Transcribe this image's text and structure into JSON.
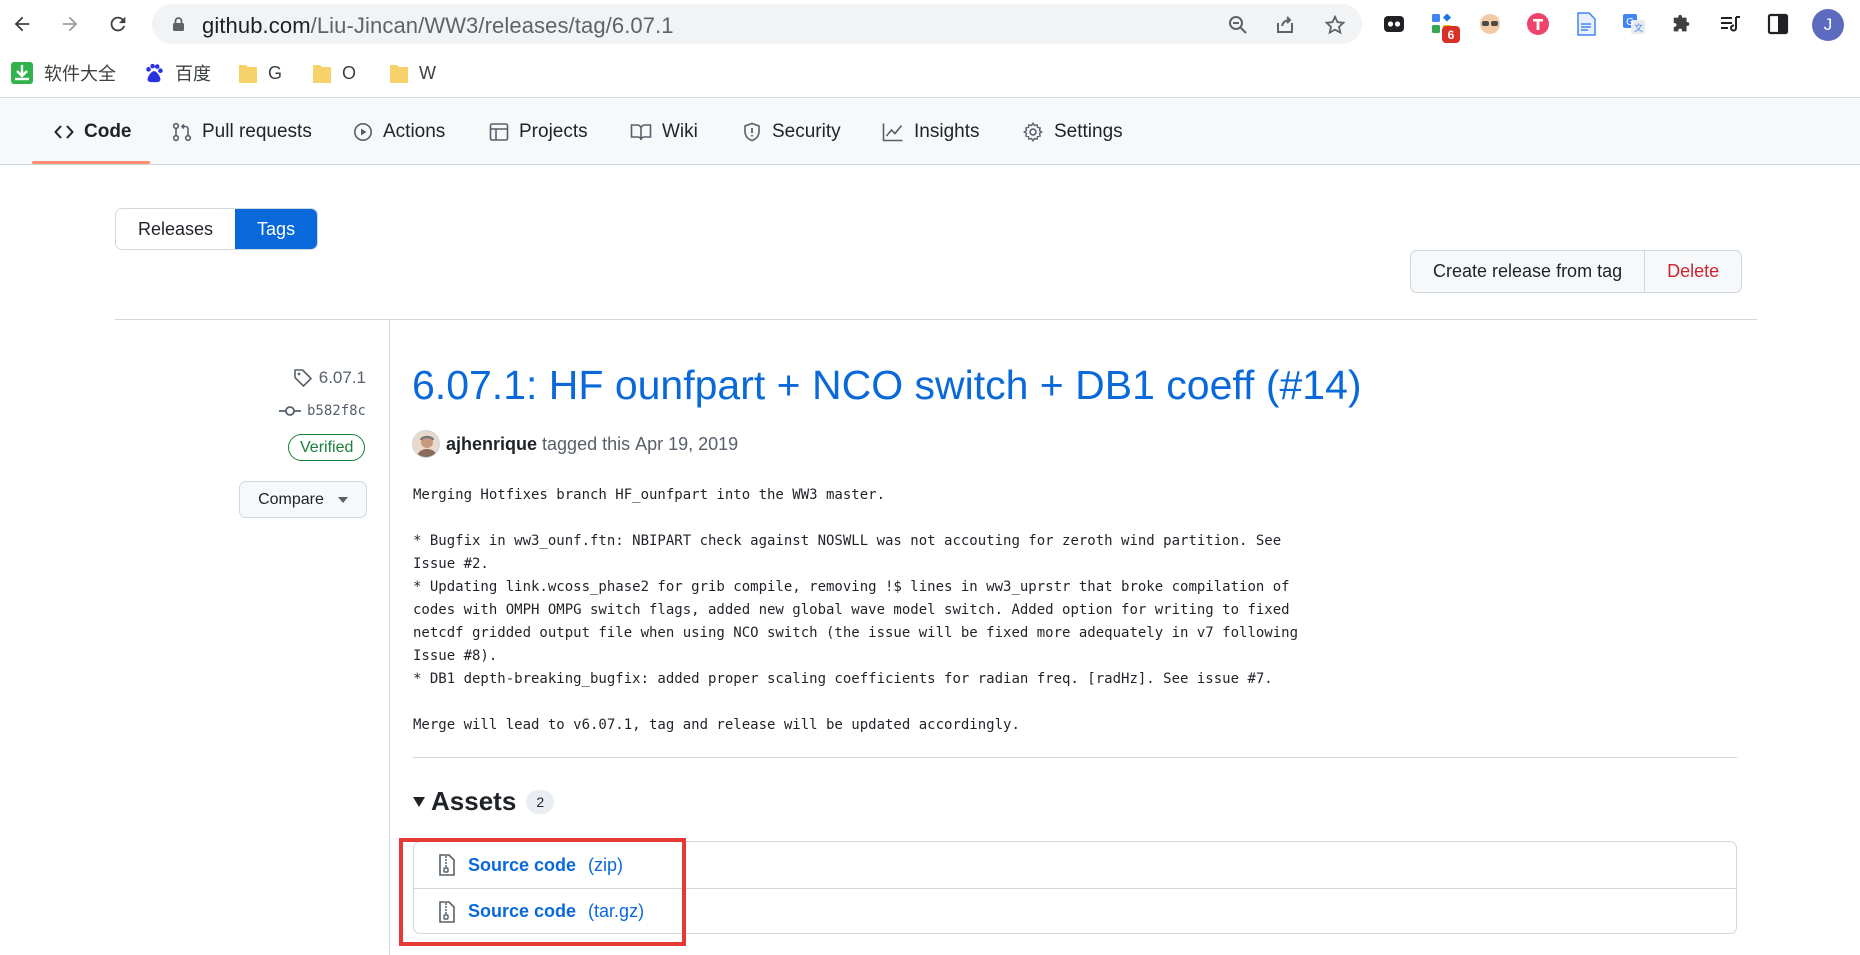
{
  "browser": {
    "url_host": "github.com",
    "url_path": "/Liu-Jincan/WW3/releases/tag/6.07.1",
    "extension_badge": "6",
    "profile_initial": "J",
    "icons": [
      "back-icon",
      "forward-icon",
      "reload-icon",
      "lock-icon",
      "zoom-icon",
      "share-icon",
      "star-icon",
      "puzzle-icon",
      "reading-list-icon",
      "side-panel-icon"
    ]
  },
  "bookmarks": [
    {
      "label": "软件大全",
      "icon": "download-icon"
    },
    {
      "label": "百度",
      "icon": "baidu-icon"
    },
    {
      "label": "G",
      "icon": "folder-icon"
    },
    {
      "label": "O",
      "icon": "folder-icon"
    },
    {
      "label": "W",
      "icon": "folder-icon"
    }
  ],
  "repo_nav": {
    "tabs": [
      {
        "label": "Code",
        "icon": "code-icon",
        "active": true
      },
      {
        "label": "Pull requests",
        "icon": "pull-request-icon"
      },
      {
        "label": "Actions",
        "icon": "play-icon"
      },
      {
        "label": "Projects",
        "icon": "table-icon"
      },
      {
        "label": "Wiki",
        "icon": "book-icon"
      },
      {
        "label": "Security",
        "icon": "shield-icon"
      },
      {
        "label": "Insights",
        "icon": "graph-icon"
      },
      {
        "label": "Settings",
        "icon": "gear-icon"
      }
    ]
  },
  "toggle": {
    "releases": "Releases",
    "tags": "Tags",
    "active": "Tags"
  },
  "actions": {
    "create": "Create release from tag",
    "delete": "Delete"
  },
  "meta": {
    "tag": "6.07.1",
    "commit": "b582f8c",
    "verified": "Verified",
    "compare": "Compare"
  },
  "release": {
    "title": "6.07.1: HF ounfpart + NCO switch + DB1 coeff (#14)",
    "author": "ajhenrique",
    "tagged_text": "tagged this",
    "date": "Apr 19, 2019",
    "notes": "Merging Hotfixes branch HF_ounfpart into the WW3 master.\n\n* Bugfix in ww3_ounf.ftn: NBIPART check against NOSWLL was not accouting for zeroth wind partition. See\nIssue #2.\n* Updating link.wcoss_phase2 for grib compile, removing !$ lines in ww3_uprstr that broke compilation of\ncodes with OMPH OMPG switch flags, added new global wave model switch. Added option for writing to fixed\nnetcdf gridded output file when using NCO switch (the issue will be fixed more adequately in v7 following\nIssue #8).\n* DB1 depth-breaking_bugfix: added proper scaling coefficients for radian freq. [radHz]. See issue #7.\n\nMerge will lead to v6.07.1, tag and release will be updated accordingly."
  },
  "assets": {
    "title": "Assets",
    "count": "2",
    "items": [
      {
        "name": "Source code",
        "ext": "(zip)"
      },
      {
        "name": "Source code",
        "ext": "(tar.gz)"
      }
    ]
  },
  "colors": {
    "link": "#0969da",
    "highlight": "#e53935",
    "verified": "#1a7f37",
    "danger": "#cf222e"
  }
}
